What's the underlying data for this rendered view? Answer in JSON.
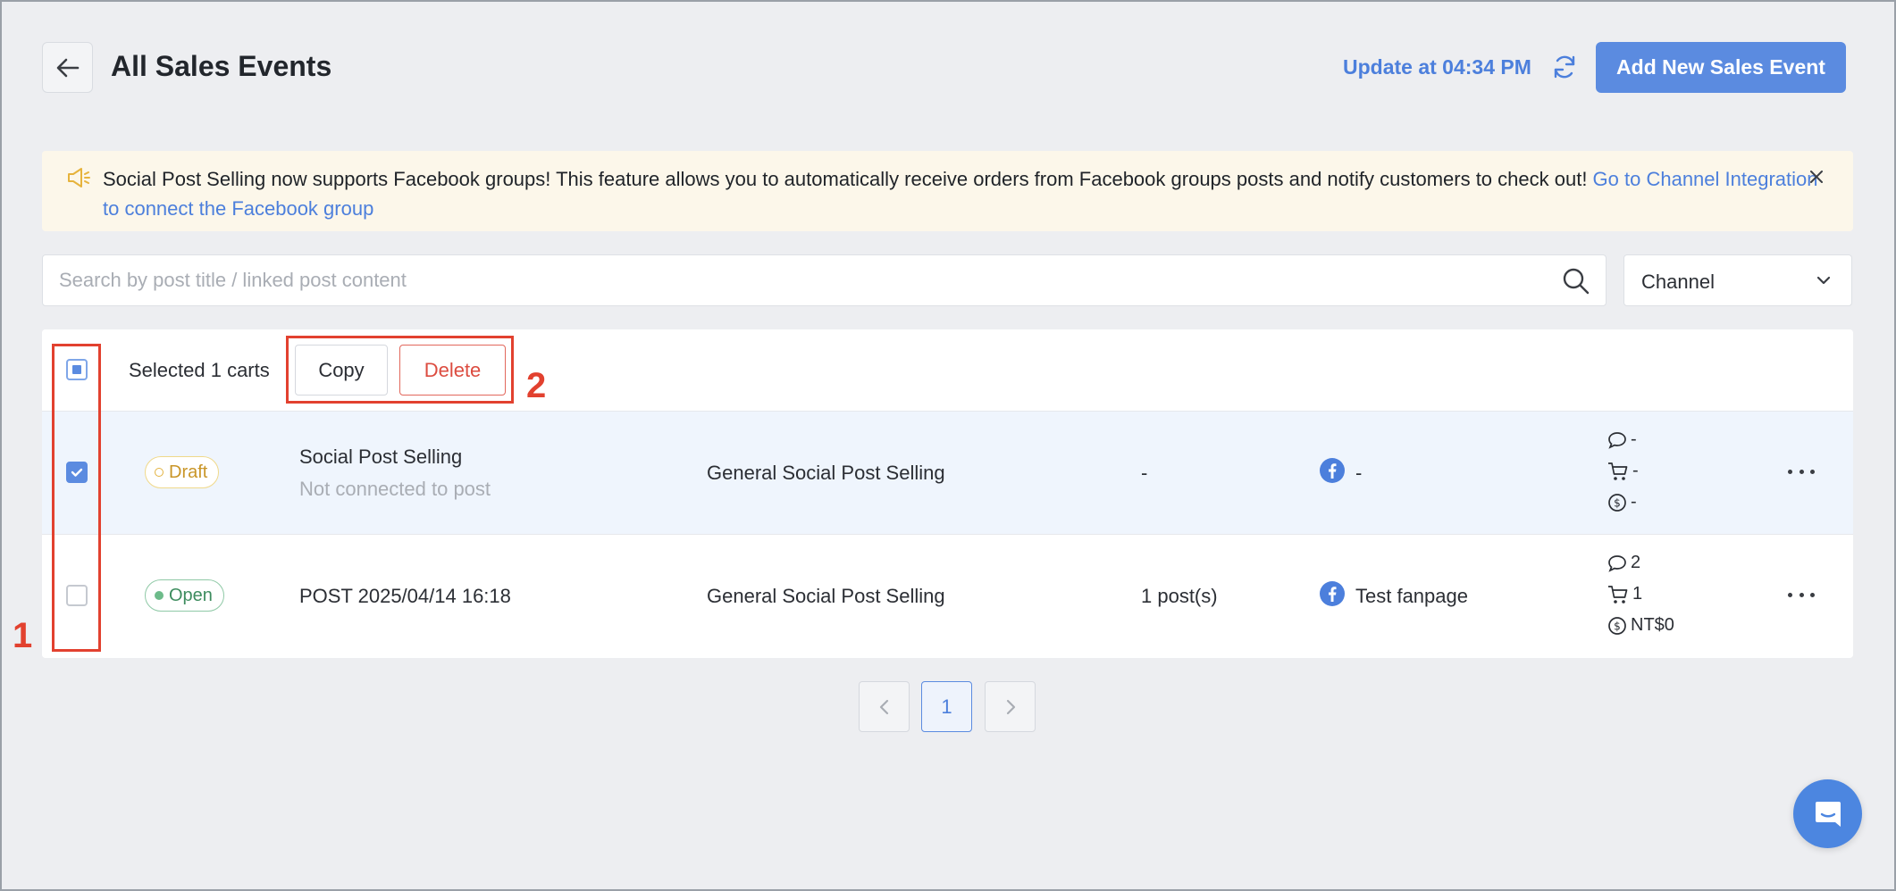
{
  "header": {
    "title": "All Sales Events",
    "update_text": "Update at 04:34 PM",
    "add_button": "Add New Sales Event"
  },
  "notice": {
    "text": "Social Post Selling now supports Facebook groups! This feature allows you to automatically receive orders from Facebook groups posts and notify customers to check out! ",
    "link": "Go to Channel Integration to connect the Facebook group"
  },
  "search": {
    "placeholder": "Search by post title / linked post content"
  },
  "filter": {
    "channel_label": "Channel"
  },
  "bulk": {
    "selected_text": "Selected 1 carts",
    "copy_label": "Copy",
    "delete_label": "Delete"
  },
  "rows": [
    {
      "status": "Draft",
      "title": "Social Post Selling",
      "subtitle": "Not connected to post",
      "type": "General Social Post Selling",
      "posts": "-",
      "channel": "-",
      "comments": "-",
      "orders": "-",
      "revenue": "-",
      "checked": true
    },
    {
      "status": "Open",
      "title": "POST 2025/04/14 16:18",
      "subtitle": "",
      "type": "General Social Post Selling",
      "posts": "1 post(s)",
      "channel": "Test fanpage",
      "comments": "2",
      "orders": "1",
      "revenue": "NT$0",
      "checked": false
    }
  ],
  "pagination": {
    "current_page": "1"
  },
  "annotations": {
    "label_1": "1",
    "label_2": "2"
  },
  "colors": {
    "accent": "#5b8be0",
    "danger": "#dc4c40",
    "annotation": "#e2412f"
  }
}
